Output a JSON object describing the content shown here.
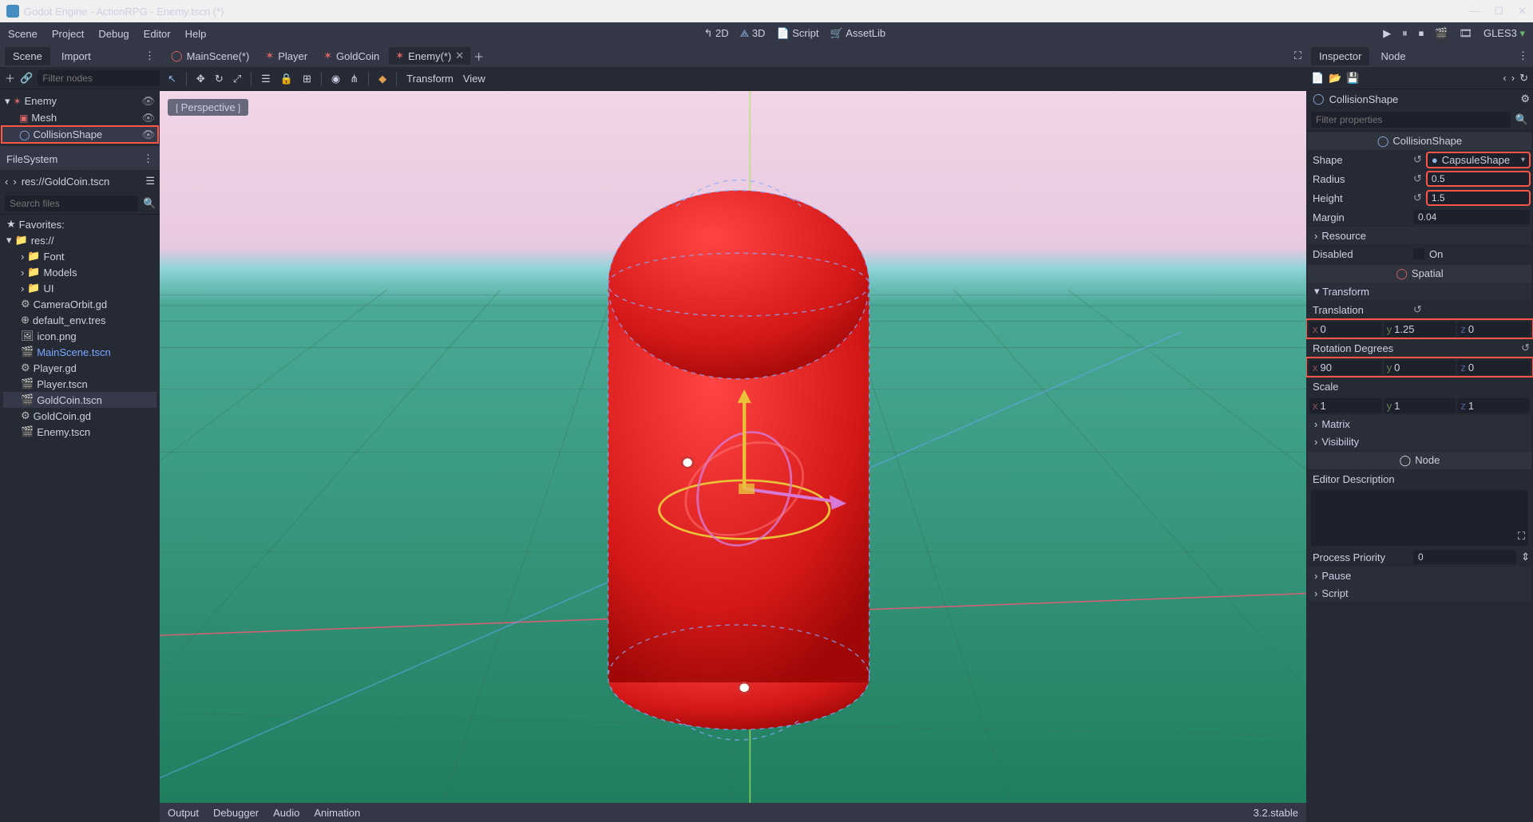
{
  "title": "Godot Engine - ActionRPG - Enemy.tscn (*)",
  "menu": [
    "Scene",
    "Project",
    "Debug",
    "Editor",
    "Help"
  ],
  "workspaces": {
    "d2": "2D",
    "d3": "3D",
    "script": "Script",
    "assetlib": "AssetLib"
  },
  "renderer": "GLES3",
  "left": {
    "tabs": {
      "scene": "Scene",
      "import": "Import"
    },
    "filter_placeholder": "Filter nodes",
    "tree": {
      "root": "Enemy",
      "mesh": "Mesh",
      "collision": "CollisionShape"
    }
  },
  "filesystem": {
    "title": "FileSystem",
    "path": "res://GoldCoin.tscn",
    "search_placeholder": "Search files",
    "favorites": "Favorites:",
    "root": "res://",
    "items": [
      "Font",
      "Models",
      "UI",
      "CameraOrbit.gd",
      "default_env.tres",
      "icon.png",
      "MainScene.tscn",
      "Player.gd",
      "Player.tscn",
      "GoldCoin.tscn",
      "GoldCoin.gd",
      "Enemy.tscn"
    ]
  },
  "scene_tabs": [
    {
      "label": "MainScene(*)",
      "icon": "red"
    },
    {
      "label": "Player",
      "icon": "red"
    },
    {
      "label": "GoldCoin",
      "icon": "red"
    },
    {
      "label": "Enemy(*)",
      "icon": "red",
      "active": true,
      "closable": true
    }
  ],
  "vp": {
    "perspective": "Perspective",
    "transform": "Transform",
    "view": "View"
  },
  "bottom": {
    "output": "Output",
    "debugger": "Debugger",
    "audio": "Audio",
    "animation": "Animation",
    "version": "3.2.stable"
  },
  "inspector": {
    "tabs": {
      "inspector": "Inspector",
      "node": "Node"
    },
    "filter_placeholder": "Filter properties",
    "node_type": "CollisionShape",
    "section1": "CollisionShape",
    "shape": {
      "label": "Shape",
      "value": "CapsuleShape"
    },
    "radius": {
      "label": "Radius",
      "value": "0.5"
    },
    "height": {
      "label": "Height",
      "value": "1.5"
    },
    "margin": {
      "label": "Margin",
      "value": "0.04"
    },
    "resource": "Resource",
    "disabled": {
      "label": "Disabled",
      "value": "On"
    },
    "spatial": "Spatial",
    "transform": "Transform",
    "translation": {
      "label": "Translation",
      "x": "0",
      "y": "1.25",
      "z": "0"
    },
    "rotation": {
      "label": "Rotation Degrees",
      "x": "90",
      "y": "0",
      "z": "0"
    },
    "scale": {
      "label": "Scale",
      "x": "1",
      "y": "1",
      "z": "1"
    },
    "matrix": "Matrix",
    "visibility": "Visibility",
    "node_section": "Node",
    "editor_desc": "Editor Description",
    "process_priority": {
      "label": "Process Priority",
      "value": "0"
    },
    "pause": "Pause",
    "script": "Script"
  }
}
